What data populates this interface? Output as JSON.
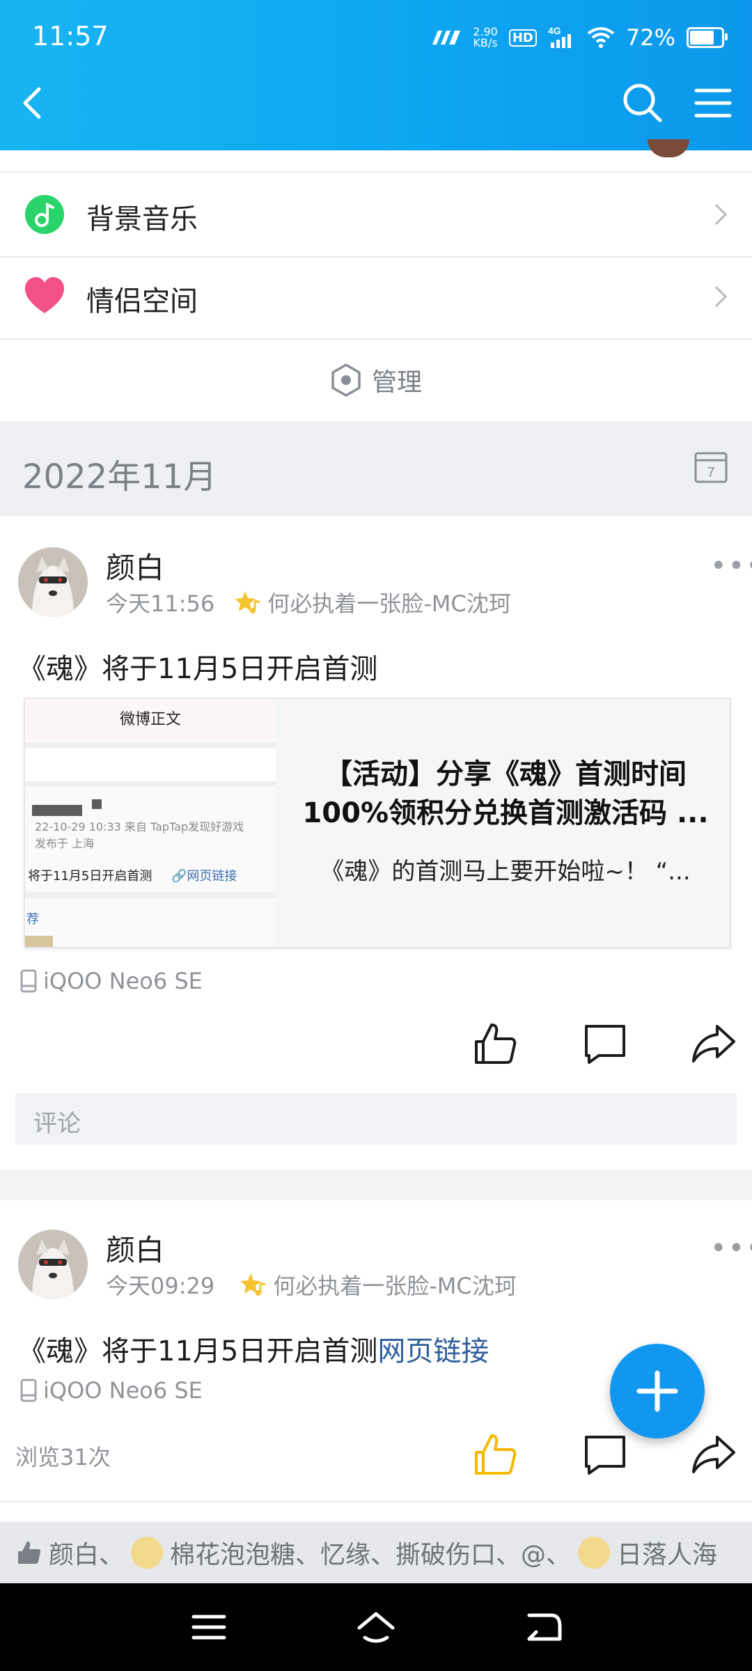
{
  "status": {
    "time": "11:57",
    "speed_value": "2.90",
    "speed_unit": "KB/s",
    "hd": "HD",
    "net": "4G",
    "battery": "72%"
  },
  "rows": [
    {
      "label": "背景音乐",
      "icon": "music-icon"
    },
    {
      "label": "情侣空间",
      "icon": "heart-icon"
    }
  ],
  "manage": {
    "label": "管理",
    "icon": "hexagon-gear-icon"
  },
  "section": {
    "month": "2022年11月",
    "calendar_day": "7"
  },
  "posts": [
    {
      "author": "颜白",
      "time": "今天11:56",
      "music": "何必执着一张脸-MC沈珂",
      "text": "《魂》将于11月5日开启首测",
      "card": {
        "thumb_header": "微博正文",
        "thumb_date": "22-10-29 10:33  来自 TapTap发现好游戏",
        "thumb_location": "发布于 上海",
        "thumb_text": "将于11月5日开启首测",
        "thumb_link": "🔗网页链接",
        "thumb_footer": "荐",
        "title": "【活动】分享《魂》首测时间100%领积分兑换首测激活码 ...",
        "desc": "《魂》的首测马上要开始啦~！  “..."
      },
      "device": "iQOO Neo6 SE",
      "comment_placeholder": "评论"
    },
    {
      "author": "颜白",
      "time": "今天09:29",
      "music": "何必执着一张脸-MC沈珂",
      "text": "《魂》将于11月5日开启首测",
      "link": "网页链接",
      "device": "iQOO Neo6 SE",
      "views": "浏览31次"
    }
  ],
  "likes": {
    "names": [
      "颜白、",
      "棉花泡泡糖、忆缘、撕破伤口、@、",
      "日落人海"
    ]
  },
  "colors": {
    "accent": "#0ea5f0",
    "liked": "#f5b800",
    "link": "#2e5f9a"
  }
}
